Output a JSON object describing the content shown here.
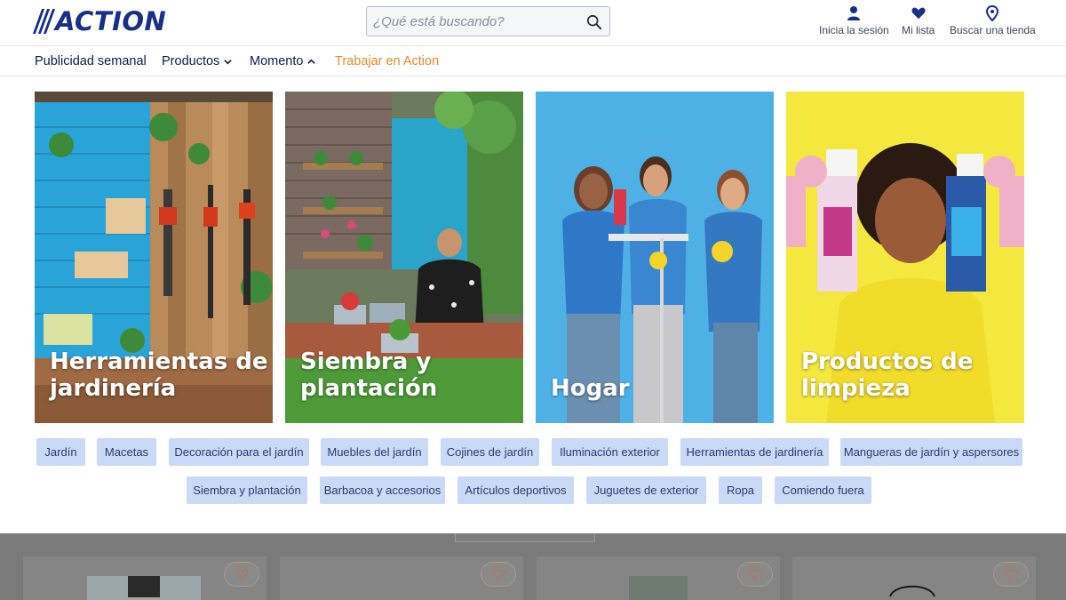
{
  "header": {
    "logo_text": "ACTION",
    "search_placeholder": "¿Qué está buscando?",
    "actions": [
      {
        "label": "Inicia la sesión",
        "icon": "user-icon"
      },
      {
        "label": "Mi lista",
        "icon": "heart-icon"
      },
      {
        "label": "Buscar una tienda",
        "icon": "location-pin-icon"
      }
    ]
  },
  "nav": {
    "items": [
      {
        "label": "Publicidad semanal"
      },
      {
        "label": "Productos",
        "icon": "chevron-down-icon"
      },
      {
        "label": "Momento",
        "icon": "chevron-up-icon"
      },
      {
        "label": "Trabajar en Action"
      }
    ]
  },
  "cards": [
    {
      "title": "Herramientas de jardinería"
    },
    {
      "title": "Siembra y plantación"
    },
    {
      "title": "Hogar"
    },
    {
      "title": "Productos de limpieza"
    }
  ],
  "chips_row1": [
    "Jardín",
    "Macetas",
    "Decoración para el jardín",
    "Muebles del jardín",
    "Cojines de jardín",
    "Iluminación exterior",
    "Herramientas de jardinería",
    "Mangueras de jardín y aspersores"
  ],
  "chips_row2": [
    "Siembra y plantación",
    "Barbacoa y accesorios",
    "Artículos deportivos",
    "Juguetes de exterior",
    "Ropa",
    "Comiendo fuera"
  ],
  "colors": {
    "brand_blue": "#1a2e8a",
    "nav_orange": "#e88a2a",
    "chip_bg": "#c9d9f6"
  }
}
